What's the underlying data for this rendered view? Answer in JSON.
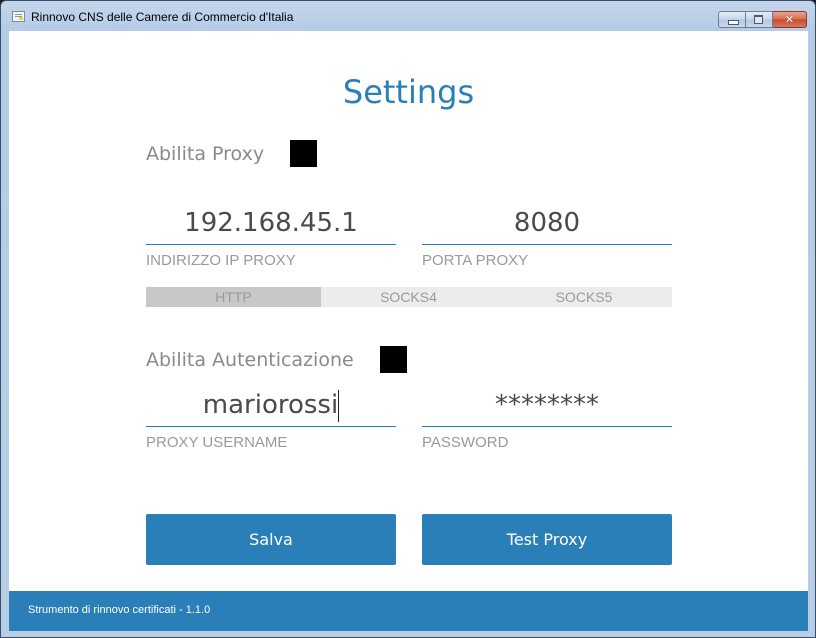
{
  "window": {
    "title": "Rinnovo CNS delle Camere di Commercio d'Italia",
    "icon": "app-window-icon",
    "controls": [
      "minimize",
      "maximize",
      "close"
    ]
  },
  "page": {
    "title": "Settings"
  },
  "proxy": {
    "enable_label": "Abilita Proxy",
    "enabled": true,
    "ip_value": "192.168.45.1",
    "ip_label": "INDIRIZZO IP PROXY",
    "port_value": "8080",
    "port_label": "PORTA PROXY",
    "protocols": [
      {
        "label": "HTTP",
        "selected": true
      },
      {
        "label": "SOCKS4",
        "selected": false
      },
      {
        "label": "SOCKS5",
        "selected": false
      }
    ]
  },
  "auth": {
    "enable_label": "Abilita Autenticazione",
    "enabled": true,
    "username_value": "mariorossi",
    "username_label": "PROXY USERNAME",
    "password_value": "********",
    "password_label": "PASSWORD"
  },
  "actions": {
    "save_label": "Salva",
    "test_label": "Test Proxy"
  },
  "footer": {
    "text": "Strumento di rinnovo certificati - 1.1.0"
  },
  "colors": {
    "accent": "#2a7fb8",
    "label_gray": "#8a8a8a",
    "protocol_active": "#c8c8c8",
    "protocol_inactive": "#ececec"
  }
}
